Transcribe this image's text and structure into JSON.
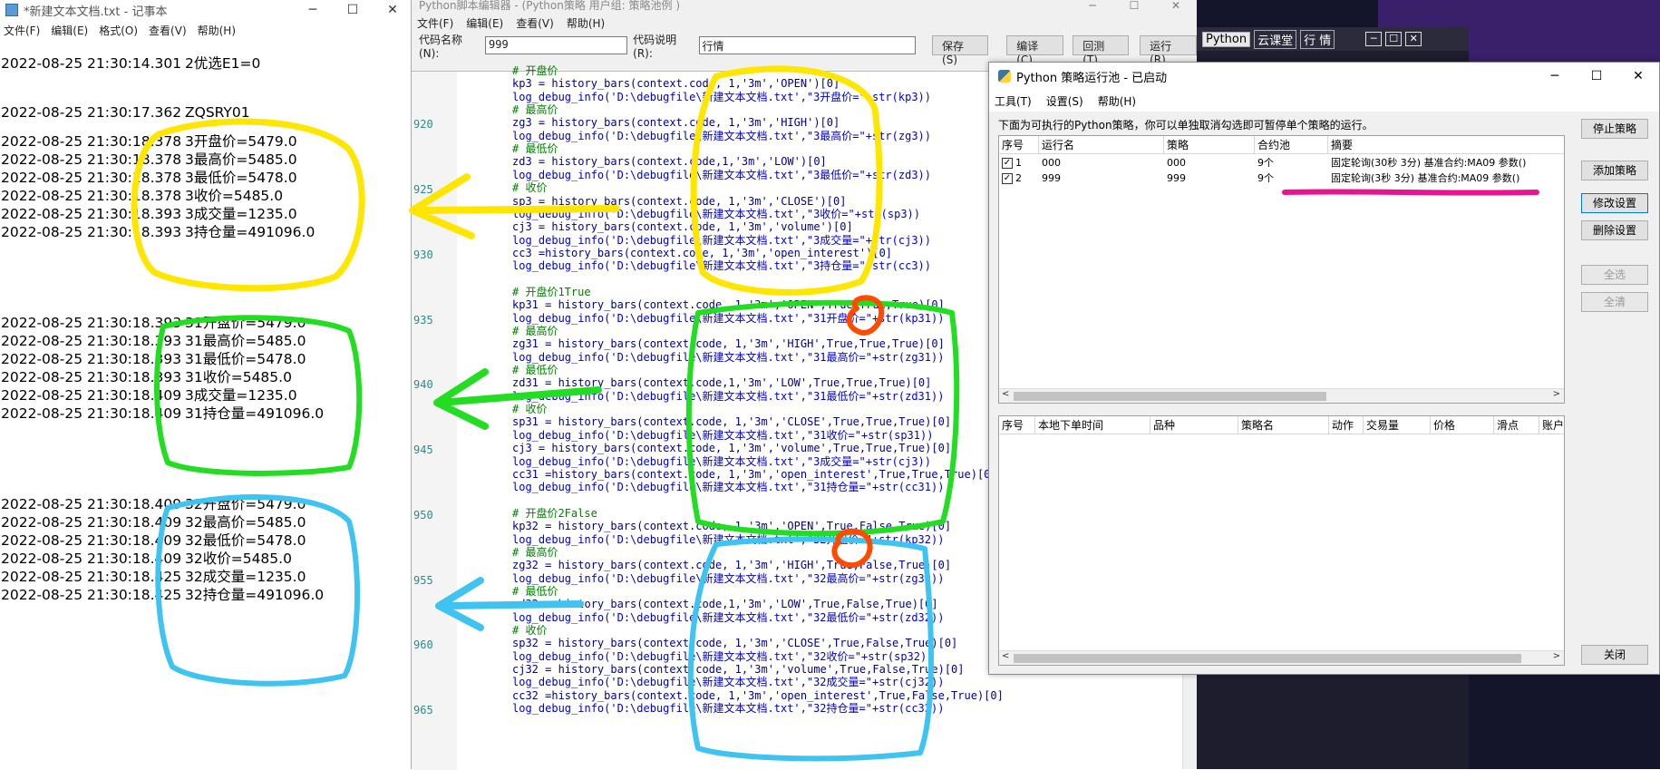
{
  "notepad": {
    "title": "*新建文本文档.txt - 记事本",
    "window_controls": [
      "─",
      "☐",
      "✕"
    ],
    "menu": [
      "文件(F)",
      "编辑(E)",
      "格式(O)",
      "查看(V)",
      "帮助(H)"
    ],
    "lines": [
      {
        "ts": "2022-08-25 21:30:14.301",
        "msg": "2优选E1=0"
      },
      {
        "ts": "2022-08-25 21:30:17.362",
        "msg": "ZQSRY01"
      },
      {
        "ts": "2022-08-25 21:30:18.378",
        "msg": "3开盘价=5479.0"
      },
      {
        "ts": "2022-08-25 21:30:18.378",
        "msg": "3最高价=5485.0"
      },
      {
        "ts": "2022-08-25 21:30:18.378",
        "msg": "3最低价=5478.0"
      },
      {
        "ts": "2022-08-25 21:30:18.378",
        "msg": "3收价=5485.0"
      },
      {
        "ts": "2022-08-25 21:30:18.393",
        "msg": "3成交量=1235.0"
      },
      {
        "ts": "2022-08-25 21:30:18.393",
        "msg": "3持仓量=491096.0"
      },
      {
        "ts": "2022-08-25 21:30:18.393",
        "msg": "31开盘价=5479.0"
      },
      {
        "ts": "2022-08-25 21:30:18.393",
        "msg": "31最高价=5485.0"
      },
      {
        "ts": "2022-08-25 21:30:18.393",
        "msg": "31最低价=5478.0"
      },
      {
        "ts": "2022-08-25 21:30:18.393",
        "msg": "31收价=5485.0"
      },
      {
        "ts": "2022-08-25 21:30:18.409",
        "msg": "3成交量=1235.0"
      },
      {
        "ts": "2022-08-25 21:30:18.409",
        "msg": "31持仓量=491096.0"
      },
      {
        "ts": "2022-08-25 21:30:18.409",
        "msg": "32开盘价=5479.0"
      },
      {
        "ts": "2022-08-25 21:30:18.409",
        "msg": "32最高价=5485.0"
      },
      {
        "ts": "2022-08-25 21:30:18.409",
        "msg": "32最低价=5478.0"
      },
      {
        "ts": "2022-08-25 21:30:18.409",
        "msg": "32收价=5485.0"
      },
      {
        "ts": "2022-08-25 21:30:18.425",
        "msg": "32成交量=1235.0"
      },
      {
        "ts": "2022-08-25 21:30:18.425",
        "msg": "32持仓量=491096.0"
      }
    ]
  },
  "editor": {
    "title": "Python脚本编辑器 - (Python策略 用户组: 策略池例 )",
    "window_controls": [
      "─",
      "☐",
      "✕"
    ],
    "menu": [
      "文件(F)",
      "编辑(E)",
      "查看(V)",
      "帮助(H)"
    ],
    "code_name_label": "代码名称(N):",
    "code_name_value": "999",
    "code_desc_label": "代码说明(R):",
    "code_desc_value": "行情",
    "buttons": [
      "保存(S)",
      "编译(C)",
      "回测(T)",
      "运行(R)"
    ],
    "line_numbers": [
      "920",
      "925",
      "930",
      "935",
      "940",
      "945",
      "950",
      "955",
      "960",
      "965"
    ],
    "code": [
      {
        "t": "comment",
        "s": "# 开盘价"
      },
      {
        "t": "code",
        "s": "kp3 = history_bars(context.code, 1,'3m','OPEN')[0]"
      },
      {
        "t": "log",
        "s": "log_debug_info('D:\\debugfile\\新建文本文档.txt',\"3开盘价=\"+str(kp3))"
      },
      {
        "t": "comment",
        "s": "# 最高价"
      },
      {
        "t": "code",
        "s": "zg3 = history_bars(context.code, 1,'3m','HIGH')[0]"
      },
      {
        "t": "log",
        "s": "log_debug_info('D:\\debugfile\\新建文本文档.txt',\"3最高价=\"+str(zg3))"
      },
      {
        "t": "comment",
        "s": "# 最低价"
      },
      {
        "t": "code",
        "s": "zd3 = history_bars(context.code,1,'3m','LOW')[0]"
      },
      {
        "t": "log",
        "s": "log_debug_info('D:\\debugfile\\新建文本文档.txt',\"3最低价=\"+str(zd3))"
      },
      {
        "t": "comment",
        "s": "# 收价"
      },
      {
        "t": "code",
        "s": "sp3 = history_bars(context.code, 1,'3m','CLOSE')[0]"
      },
      {
        "t": "log",
        "s": "log_debug_info('D:\\debugfile\\新建文本文档.txt',\"3收价=\"+str(sp3))"
      },
      {
        "t": "code",
        "s": "cj3 = history_bars(context.code, 1,'3m','volume')[0]"
      },
      {
        "t": "log",
        "s": "log_debug_info('D:\\debugfile\\新建文本文档.txt',\"3成交量=\"+str(cj3))"
      },
      {
        "t": "code",
        "s": "cc3 =history_bars(context.code, 1,'3m','open_interest')[0]"
      },
      {
        "t": "log",
        "s": "log_debug_info('D:\\debugfile\\新建文本文档.txt',\"3持仓量=\"+str(cc3))"
      },
      {
        "t": "blank",
        "s": ""
      },
      {
        "t": "comment",
        "s": "# 开盘价1True"
      },
      {
        "t": "code",
        "s": "kp31 = history_bars(context.code, 1,'3m','OPEN',True,True,True)[0]"
      },
      {
        "t": "log",
        "s": "log_debug_info('D:\\debugfile\\新建文本文档.txt',\"31开盘价=\"+str(kp31))"
      },
      {
        "t": "comment",
        "s": "# 最高价"
      },
      {
        "t": "code",
        "s": "zg31 = history_bars(context.code, 1,'3m','HIGH',True,True,True)[0]"
      },
      {
        "t": "log",
        "s": "log_debug_info('D:\\debugfile\\新建文本文档.txt',\"31最高价=\"+str(zg31))"
      },
      {
        "t": "comment",
        "s": "# 最低价"
      },
      {
        "t": "code",
        "s": "zd31 = history_bars(context.code,1,'3m','LOW',True,True,True)[0]"
      },
      {
        "t": "log",
        "s": "log_debug_info('D:\\debugfile\\新建文本文档.txt',\"31最低价=\"+str(zd31))"
      },
      {
        "t": "comment",
        "s": "# 收价"
      },
      {
        "t": "code",
        "s": "sp31 = history_bars(context.code, 1,'3m','CLOSE',True,True,True)[0]"
      },
      {
        "t": "log",
        "s": "log_debug_info('D:\\debugfile\\新建文本文档.txt',\"31收价=\"+str(sp31))"
      },
      {
        "t": "code",
        "s": "cj3 = history_bars(context.code, 1,'3m','volume',True,True,True)[0]"
      },
      {
        "t": "log",
        "s": "log_debug_info('D:\\debugfile\\新建文本文档.txt',\"3成交量=\"+str(cj3))"
      },
      {
        "t": "code",
        "s": "cc31 =history_bars(context.code, 1,'3m','open_interest',True,True,True)[0]"
      },
      {
        "t": "log",
        "s": "log_debug_info('D:\\debugfile\\新建文本文档.txt',\"31持仓量=\"+str(cc31))"
      },
      {
        "t": "blank",
        "s": ""
      },
      {
        "t": "comment",
        "s": "# 开盘价2False"
      },
      {
        "t": "code",
        "s": "kp32 = history_bars(context.code, 1,'3m','OPEN',True,False,True)[0]"
      },
      {
        "t": "log",
        "s": "log_debug_info('D:\\debugfile\\新建文本文档.txt',\"32开盘价=\"+str(kp32))"
      },
      {
        "t": "comment",
        "s": "# 最高价"
      },
      {
        "t": "code",
        "s": "zg32 = history_bars(context.code, 1,'3m','HIGH',True,False,True)[0]"
      },
      {
        "t": "log",
        "s": "log_debug_info('D:\\debugfile\\新建文本文档.txt',\"32最高价=\"+str(zg32))"
      },
      {
        "t": "comment",
        "s": "# 最低价"
      },
      {
        "t": "code",
        "s": "zd32 = history_bars(context.code,1,'3m','LOW',True,False,True)[0]"
      },
      {
        "t": "log",
        "s": "log_debug_info('D:\\debugfile\\新建文本文档.txt',\"32最低价=\"+str(zd32))"
      },
      {
        "t": "comment",
        "s": "# 收价"
      },
      {
        "t": "code",
        "s": "sp32 = history_bars(context.code, 1,'3m','CLOSE',True,False,True)[0]"
      },
      {
        "t": "log",
        "s": "log_debug_info('D:\\debugfile\\新建文本文档.txt',\"32收价=\"+str(sp32))"
      },
      {
        "t": "code",
        "s": "cj32 = history_bars(context.code, 1,'3m','volume',True,False,True)[0]"
      },
      {
        "t": "log",
        "s": "log_debug_info('D:\\debugfile\\新建文本文档.txt',\"32成交量=\"+str(cj32))"
      },
      {
        "t": "code",
        "s": "cc32 =history_bars(context.code, 1,'3m','open_interest',True,False,True)[0]"
      },
      {
        "t": "log",
        "s": "log_debug_info('D:\\debugfile\\新建文本文档.txt',\"32持仓量=\"+str(cc32))"
      }
    ]
  },
  "mini_bar": {
    "tags": [
      "Python",
      "云课堂",
      "行 情"
    ],
    "controls": [
      "─",
      "☐",
      "✕"
    ]
  },
  "pool": {
    "title": "Python 策略运行池 - 已启动",
    "window_controls": [
      "─",
      "☐",
      "✕"
    ],
    "menu": [
      "工具(T)",
      "设置(S)",
      "帮助(H)"
    ],
    "description": "下面为可执行的Python策略，你可以单独取消勾选即可暂停单个策略的运行。",
    "top_table": {
      "headers": [
        "序号",
        "运行名",
        "策略",
        "合约池",
        "摘要"
      ],
      "rows": [
        {
          "checked": true,
          "num": "1",
          "name": "000",
          "strategy": "000",
          "pool": "9个",
          "summary": "固定轮询(30秒 3分) 基准合约:MA09 参数()"
        },
        {
          "checked": true,
          "num": "2",
          "name": "999",
          "strategy": "999",
          "pool": "9个",
          "summary": "固定轮询(3秒 3分) 基准合约:MA09 参数()"
        }
      ]
    },
    "bottom_table": {
      "headers": [
        "序号",
        "本地下单时间",
        "品种",
        "策略名",
        "动作",
        "交易量",
        "价格",
        "滑点",
        "账户"
      ]
    },
    "buttons": {
      "stop": "停止策略",
      "add": "添加策略",
      "modify": "修改设置",
      "delete": "删除设置",
      "select_all": "全选",
      "clear_all": "全清",
      "close": "关闭"
    },
    "scroll_arrows": [
      "<",
      ">"
    ]
  },
  "annotation_colors": {
    "yellow": "#ffe600",
    "green": "#22dd22",
    "blue": "#3fc3f0",
    "orange": "#ff4a00",
    "pink": "#e8168c"
  }
}
